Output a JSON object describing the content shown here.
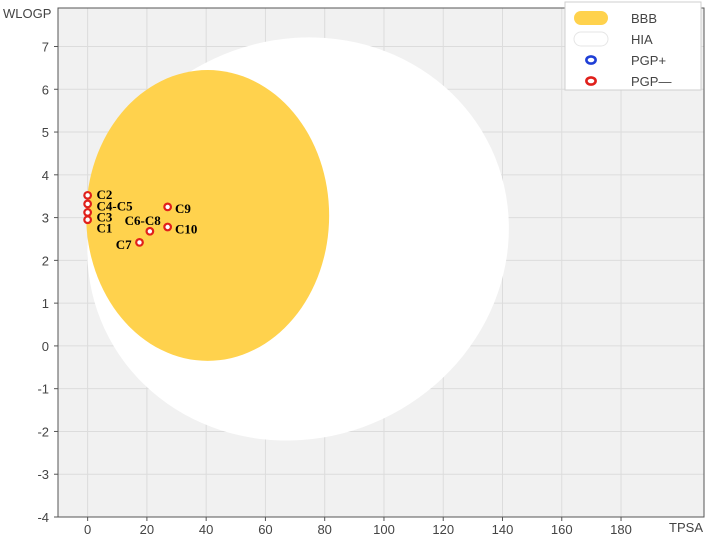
{
  "chart_data": {
    "type": "scatter",
    "xlabel": "TPSA",
    "ylabel": "WLOGP",
    "xlim": [
      -10,
      208
    ],
    "ylim": [
      -4,
      7.9
    ],
    "x_ticks": [
      0,
      20,
      40,
      60,
      80,
      100,
      120,
      140,
      160,
      180
    ],
    "y_ticks": [
      -4,
      -3,
      -2,
      -1,
      0,
      1,
      2,
      3,
      4,
      5,
      6,
      7
    ],
    "tick_labels": {
      "x": [
        "0",
        "20",
        "40",
        "60",
        "80",
        "100",
        "120",
        "140",
        "160",
        "180"
      ],
      "y": [
        "-4",
        "-3",
        "-2",
        "-1",
        "0",
        "1",
        "2",
        "3",
        "4",
        "5",
        "6",
        "7"
      ]
    },
    "grid": true,
    "legend_position": "top-right",
    "legend": [
      {
        "label": "BBB",
        "kind": "yolk",
        "color": "#ffd24d"
      },
      {
        "label": "HIA",
        "kind": "egg-white",
        "color": "#ffffff"
      },
      {
        "label": "PGP+",
        "kind": "point",
        "color": "#1f3fd6"
      },
      {
        "label": "PGP—",
        "kind": "point",
        "color": "#e0201b"
      }
    ],
    "regions": [
      {
        "name": "HIA",
        "cx": 71.0,
        "cy": 2.5,
        "rx": 72.0,
        "ry": 4.65,
        "rotation_deg": -25,
        "color": "#ffffff"
      },
      {
        "name": "BBB",
        "cx": 40.5,
        "cy": 3.05,
        "rx": 41.0,
        "ry": 3.4,
        "rotation_deg": 0,
        "color": "#ffd24d"
      }
    ],
    "points": [
      {
        "x": 0.0,
        "y": 3.52,
        "class": "PGP-"
      },
      {
        "x": 0.0,
        "y": 3.32,
        "class": "PGP-"
      },
      {
        "x": 0.0,
        "y": 3.12,
        "class": "PGP-"
      },
      {
        "x": 0.0,
        "y": 2.95,
        "class": "PGP-"
      },
      {
        "x": 27.0,
        "y": 3.25,
        "class": "PGP-"
      },
      {
        "x": 21.0,
        "y": 2.68,
        "class": "PGP-"
      },
      {
        "x": 27.0,
        "y": 2.78,
        "class": "PGP-"
      },
      {
        "x": 17.5,
        "y": 2.42,
        "class": "PGP-"
      }
    ],
    "annotations": [
      {
        "text": "C2",
        "x": 3,
        "y": 3.55
      },
      {
        "text": "C4-C5",
        "x": 3,
        "y": 3.28
      },
      {
        "text": "C3",
        "x": 3,
        "y": 3.02
      },
      {
        "text": "C1",
        "x": 3,
        "y": 2.77
      },
      {
        "text": "C9",
        "x": 29.5,
        "y": 3.22
      },
      {
        "text": "C6-C8",
        "x": 12.5,
        "y": 2.94
      },
      {
        "text": "C10",
        "x": 29.5,
        "y": 2.74
      },
      {
        "text": "C7",
        "x": 9.5,
        "y": 2.38
      }
    ]
  }
}
